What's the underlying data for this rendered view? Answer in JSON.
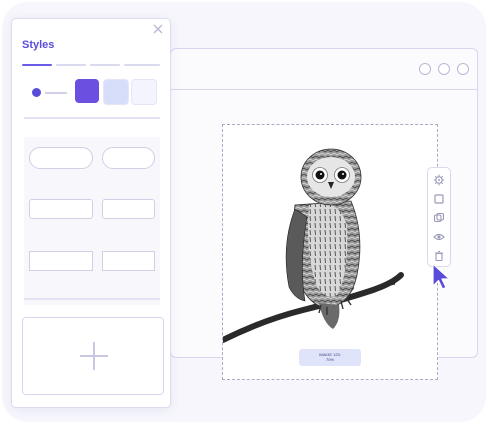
{
  "panel": {
    "title": "Styles",
    "accent_color": "#5a4cdb",
    "swatches": [
      "#6b4fe0",
      "#d7defa",
      "#f3f4fd"
    ],
    "close_icon": "close-icon",
    "add_icon": "plus-icon"
  },
  "canvas": {
    "image_subject": "owl-photo",
    "label_line1": "IMAGE 123:",
    "label_line2": "70%"
  },
  "toolbar": {
    "icons": [
      "gear-icon",
      "square-icon",
      "copy-icon",
      "eye-icon",
      "trash-icon"
    ]
  },
  "cursor": {
    "color": "#5a4cdb"
  }
}
